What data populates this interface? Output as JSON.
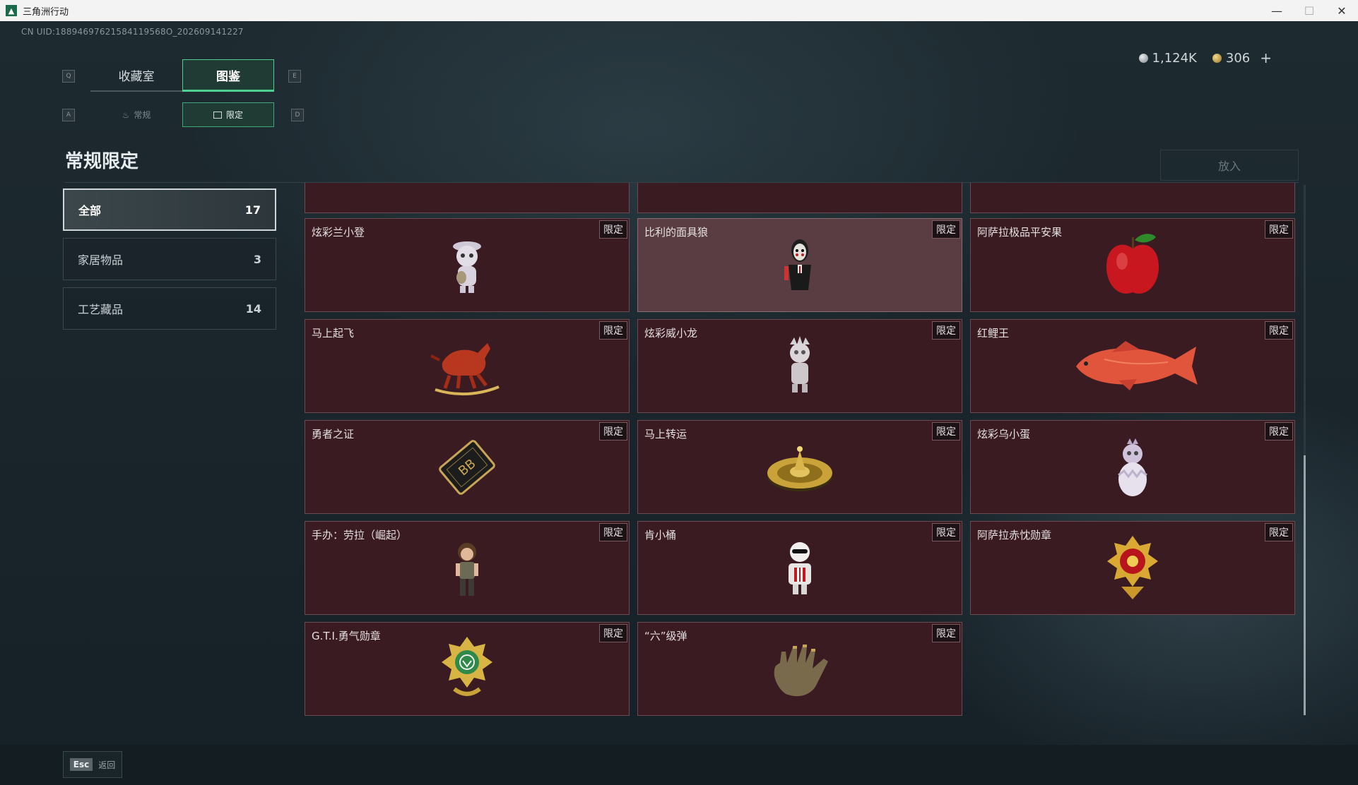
{
  "window": {
    "title": "三角洲行动",
    "minimize": "—",
    "maximize": "☐",
    "close": "✕"
  },
  "uid": "CN UID:18894697621584119568O_202609141227",
  "currency": [
    {
      "value": "1,124K",
      "color": "#a9b1b4"
    },
    {
      "value": "306",
      "color": "#c9a04a",
      "plus": "+"
    }
  ],
  "keys": {
    "q": "Q",
    "e": "E",
    "a": "A",
    "d": "D"
  },
  "tabs": [
    {
      "label": "收藏室"
    },
    {
      "label": "图鉴"
    }
  ],
  "subtabs": [
    {
      "label": "常规",
      "icon": "flame-icon"
    },
    {
      "label": "限定",
      "icon": "image-icon"
    }
  ],
  "section_title": "常规限定",
  "place_button": "放入",
  "categories": [
    {
      "label": "全部",
      "count": "17"
    },
    {
      "label": "家居物品",
      "count": "3"
    },
    {
      "label": "工艺藏品",
      "count": "14"
    }
  ],
  "tag_label": "限定",
  "items": [
    {
      "name": "炫彩兰小登",
      "icon": "figurine-icon"
    },
    {
      "name": "比利的面具狼",
      "icon": "puppet-icon"
    },
    {
      "name": "阿萨拉极品平安果",
      "icon": "apple-icon"
    },
    {
      "name": "马上起飞",
      "icon": "horse-icon"
    },
    {
      "name": "炫彩威小龙",
      "icon": "dragon-figurine-icon"
    },
    {
      "name": "红鲤王",
      "icon": "carp-icon"
    },
    {
      "name": "勇者之证",
      "icon": "card-icon"
    },
    {
      "name": "马上转运",
      "icon": "spinner-icon"
    },
    {
      "name": "炫彩乌小蛋",
      "icon": "egg-figurine-icon"
    },
    {
      "name": "手办：劳拉（崛起）",
      "icon": "lara-figure-icon"
    },
    {
      "name": "肯小桶",
      "icon": "bucket-figure-icon"
    },
    {
      "name": "阿萨拉赤忱勋章",
      "icon": "red-medal-icon"
    },
    {
      "name": "G.T.I.勇气勋章",
      "icon": "green-medal-icon"
    },
    {
      "name": "“六”级弹",
      "icon": "hand-bullet-icon"
    }
  ],
  "esc": {
    "key": "Esc",
    "label": "返回"
  }
}
